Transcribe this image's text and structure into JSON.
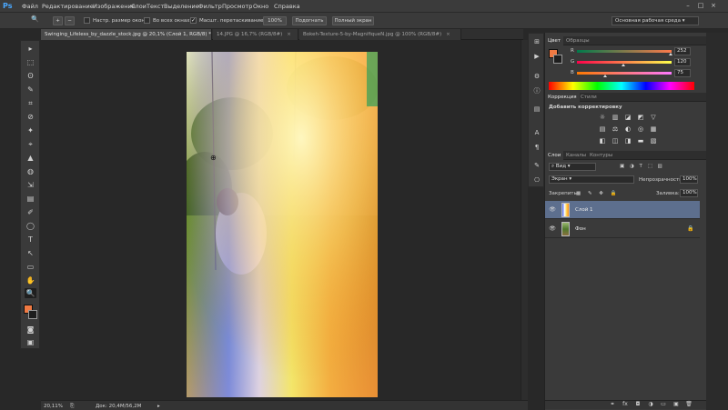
{
  "app": {
    "logo": "Ps"
  },
  "menu": [
    "Файл",
    "Редактирование",
    "Изображение",
    "Слои",
    "Текст",
    "Выделение",
    "Фильтр",
    "Просмотр",
    "Окно",
    "Справка"
  ],
  "window_controls": [
    "–",
    "□",
    "×"
  ],
  "options": {
    "zoom_tool": "🔍",
    "chk1_label": "Настр. размер окон",
    "chk2_label": "Во всех окнах",
    "chk3_label": "Масшт. перетаскиванием",
    "btn_100": "100%",
    "btn_fit": "Подогнать",
    "btn_fullscreen": "Полный экран",
    "workspace": "Основная рабочая среда"
  },
  "doc_tabs": [
    {
      "label": "Swinging_Lifeless_by_dazzle_stock.jpg @ 20,1% (Слой 1, RGB/8) *",
      "close": "×"
    },
    {
      "label": "14.JPG @ 16,7% (RGB/8#)",
      "close": "×"
    },
    {
      "label": "Bokeh-Texture-5-by-MagnifiqueN.jpg @ 100% (RGB/8#)",
      "close": "×"
    }
  ],
  "status": {
    "zoom": "20,11%",
    "doc": "Док: 20,4M/56,2M"
  },
  "tools": [
    "▸",
    "⬚",
    "ʘ",
    "✎",
    "⌗",
    "⊘",
    "✦",
    "⌖",
    "▲",
    "◍",
    "⇲",
    "▤",
    "✐",
    "◯",
    "T",
    "↖",
    "▭",
    "✋",
    "🔍"
  ],
  "color_panel": {
    "tabs": [
      "Цвет",
      "Образцы"
    ],
    "fg_color": "#f07a43",
    "r": {
      "label": "R",
      "value": "252"
    },
    "g": {
      "label": "G",
      "value": "120"
    },
    "b": {
      "label": "B",
      "value": "75"
    }
  },
  "adjust_panel": {
    "tabs": [
      "Коррекция",
      "Стили"
    ],
    "title": "Добавить корректировку",
    "icons_row1": [
      "☼",
      "▥",
      "◪",
      "◩",
      "▽"
    ],
    "icons_row2": [
      "▤",
      "⚖",
      "◐",
      "◎",
      "▦"
    ],
    "icons_row3": [
      "◧",
      "◫",
      "◨",
      "▬",
      "▧"
    ]
  },
  "layers_panel": {
    "tabs": [
      "Слои",
      "Каналы",
      "Контуры"
    ],
    "kind": "Вид",
    "blend_mode": "Экран",
    "opacity_label": "Непрозрачность:",
    "opacity_value": "100%",
    "lock_label": "Закрепить:",
    "fill_label": "Заливка:",
    "fill_value": "100%",
    "layers": [
      {
        "name": "Слой 1",
        "selected": true
      },
      {
        "name": "Фон",
        "selected": false,
        "locked": "🔒"
      }
    ],
    "footer_icons": [
      "⚭",
      "fx",
      "◘",
      "◑",
      "▭",
      "▣",
      "🗑"
    ]
  }
}
